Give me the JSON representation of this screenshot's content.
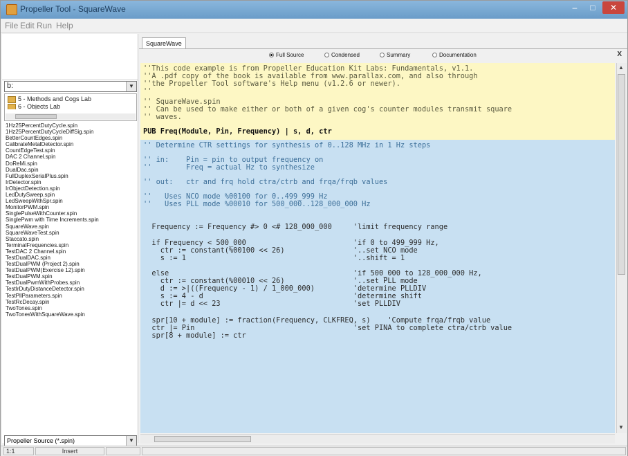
{
  "window": {
    "title": "Propeller Tool - SquareWave"
  },
  "menu": [
    "File",
    "Edit",
    "Run",
    "Help"
  ],
  "left": {
    "drive": "b:",
    "folders": [
      "5 - Methods and Cogs Lab",
      "6 - Objects Lab"
    ],
    "files": [
      "1Hz25PercentDutyCycle.spin",
      "1Hz25PercentDutyCycleDiffSig.spin",
      "BetterCountEdges.spin",
      "CalibrateMetalDetector.spin",
      "CountEdgeTest.spin",
      "DAC 2 Channel.spin",
      "DoReMi.spin",
      "DualDac.spin",
      "FullDuplexSerialPlus.spin",
      "IrDetector.spin",
      "IrObjectDetection.spin",
      "LedDutySweep.spin",
      "LedSweepWithSpr.spin",
      "MonitorPWM.spin",
      "SinglePulseWithCounter.spin",
      "SinglePwm with Time Increments.spin",
      "SquareWave.spin",
      "SquareWaveTest.spin",
      "Staccato.spin",
      "TerminalFrequencies.spin",
      "TestDAC 2 Channel.spin",
      "TestDualDAC.spin",
      "TestDualPWM (Project 2).spin",
      "TestDualPWM(Exercise 12).spin",
      "TestDualPWM.spin",
      "TestDualPwmWithProbes.spin",
      "TestIrDutyDistanceDetector.spin",
      "TestPllParameters.spin",
      "TestRcDecay.spin",
      "TwoTones.spin",
      "TwoTonesWithSquareWave.spin"
    ],
    "filter": "Propeller Source (*.spin)"
  },
  "editor": {
    "tab": "SquareWave",
    "views": [
      "Full Source",
      "Condensed",
      "Summary",
      "Documentation"
    ],
    "selected_view": "Full Source",
    "close_label": "X",
    "lines": [
      "''This code example is from Propeller Education Kit Labs: Fundamentals, v1.1.",
      "''A .pdf copy of the book is available from www.parallax.com, and also through",
      "''the Propeller Tool software's Help menu (v1.2.6 or newer).",
      "''",
      "'' SquareWave.spin",
      "'' Can be used to make either or both of a given cog's counter modules transmit square",
      "'' waves.",
      "PUB Freq(Module, Pin, Frequency) | s, d, ctr",
      "'' Determine CTR settings for synthesis of 0..128 MHz in 1 Hz steps",
      "'' in:    Pin = pin to output frequency on",
      "''        Freq = actual Hz to synthesize",
      "'' out:   ctr and frq hold ctra/ctrb and frqa/frqb values",
      "''   Uses NCO mode %00100 for 0..499_999 Hz",
      "''   Uses PLL mode %00010 for 500_000..128_000_000 Hz",
      "  Frequency := Frequency #> 0 <# 128_000_000     'limit frequency range",
      "  if Frequency < 500_000                         'if 0 to 499_999 Hz,",
      "    ctr := constant(%00100 << 26)                '..set NCO mode",
      "    s := 1                                       '..shift = 1",
      "  else                                           'if 500_000 to 128_000_000 Hz,",
      "    ctr := constant(%00010 << 26)                '..set PLL mode",
      "    d := >|((Frequency - 1) / 1_000_000)         'determine PLLDIV",
      "    s := 4 - d                                   'determine shift",
      "    ctr |= d << 23                               'set PLLDIV",
      "  spr[10 + module] := fraction(Frequency, CLKFREQ, s)    'Compute frqa/frqb value",
      "  ctr |= Pin                                     'set PINA to complete ctra/ctrb value",
      "  spr[8 + module] := ctr"
    ]
  },
  "status": {
    "position": "1:1",
    "mode": "Insert"
  }
}
